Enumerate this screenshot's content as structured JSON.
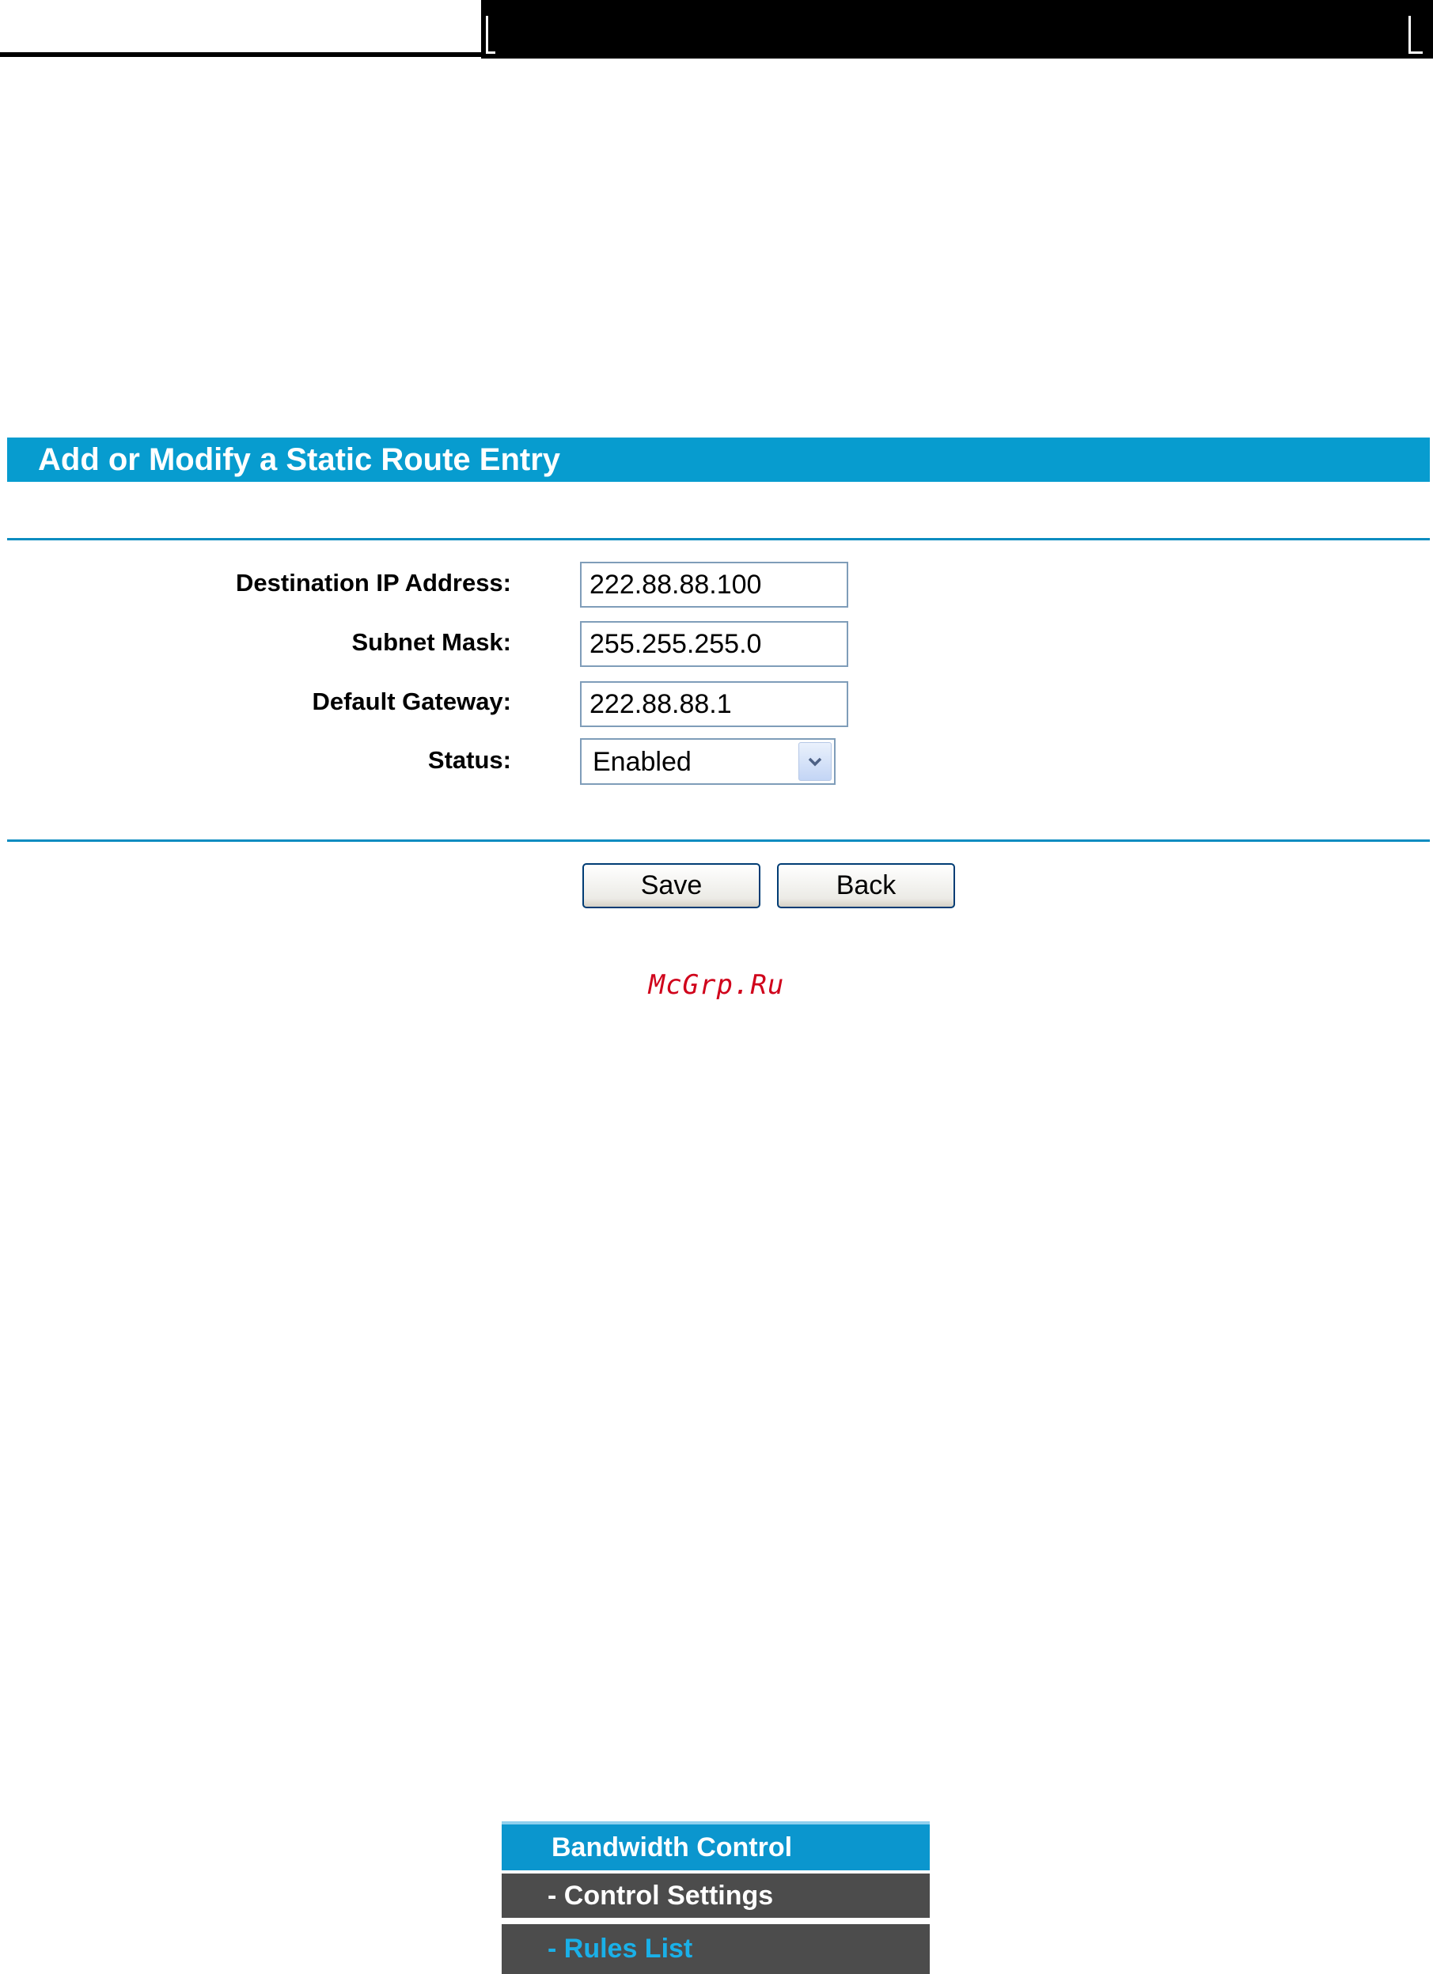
{
  "panel": {
    "title": "Add or Modify a Static Route Entry"
  },
  "form": {
    "destination": {
      "label": "Destination IP Address:",
      "value": "222.88.88.100"
    },
    "subnet": {
      "label": "Subnet Mask:",
      "value": "255.255.255.0"
    },
    "gateway": {
      "label": "Default Gateway:",
      "value": "222.88.88.1"
    },
    "status": {
      "label": "Status:",
      "value": "Enabled"
    }
  },
  "buttons": {
    "save_label": "Save",
    "back_label": "Back"
  },
  "watermark": "McGrp.Ru",
  "menu": {
    "items": [
      {
        "label": "Bandwidth Control"
      },
      {
        "label": "- Control Settings"
      },
      {
        "label": "- Rules List"
      }
    ]
  },
  "colors": {
    "header_blue": "#079ccf",
    "rule_blue": "#0a8cc0",
    "menu_dark": "#4c4c4c",
    "menu_active_text": "#1ab0e8",
    "watermark_red": "#d0021b"
  },
  "icons": {
    "status_dropdown": "chevron-down-icon"
  }
}
